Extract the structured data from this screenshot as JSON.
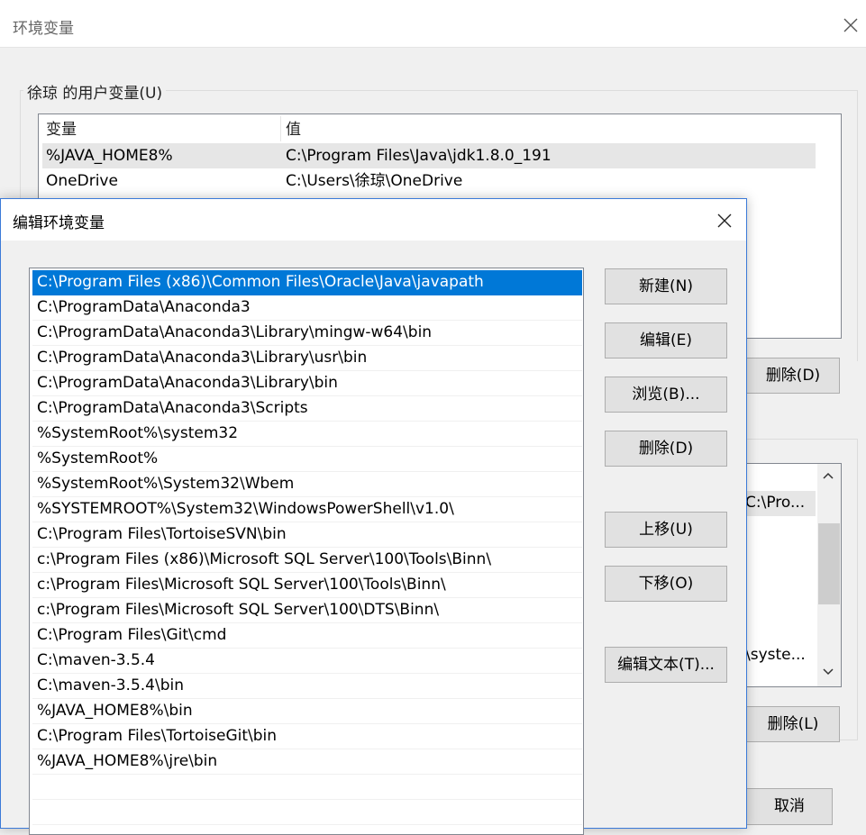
{
  "background_window": {
    "title": "环境变量",
    "user_vars_label": "徐琼 的用户变量(U)",
    "user_table": {
      "columns": [
        "变量",
        "值"
      ],
      "rows": [
        {
          "name": "%JAVA_HOME8%",
          "value": "C:\\Program Files\\Java\\jdk1.8.0_191"
        },
        {
          "name": "OneDrive",
          "value": "C:\\Users\\徐琼\\OneDrive"
        }
      ]
    },
    "delete_user_label": "删除(D)",
    "system_table_fragments": [
      "C:\\Pro...",
      "\\syste..."
    ],
    "delete_system_label": "删除(L)",
    "cancel_label": "取消"
  },
  "dialog": {
    "title": "编辑环境变量",
    "paths": [
      "C:\\Program Files (x86)\\Common Files\\Oracle\\Java\\javapath",
      "C:\\ProgramData\\Anaconda3",
      "C:\\ProgramData\\Anaconda3\\Library\\mingw-w64\\bin",
      "C:\\ProgramData\\Anaconda3\\Library\\usr\\bin",
      "C:\\ProgramData\\Anaconda3\\Library\\bin",
      "C:\\ProgramData\\Anaconda3\\Scripts",
      "%SystemRoot%\\system32",
      "%SystemRoot%",
      "%SystemRoot%\\System32\\Wbem",
      "%SYSTEMROOT%\\System32\\WindowsPowerShell\\v1.0\\",
      "C:\\Program Files\\TortoiseSVN\\bin",
      "c:\\Program Files (x86)\\Microsoft SQL Server\\100\\Tools\\Binn\\",
      "c:\\Program Files\\Microsoft SQL Server\\100\\Tools\\Binn\\",
      "c:\\Program Files\\Microsoft SQL Server\\100\\DTS\\Binn\\",
      "C:\\Program Files\\Git\\cmd",
      "C:\\maven-3.5.4",
      "C:\\maven-3.5.4\\bin",
      "%JAVA_HOME8%\\bin",
      "C:\\Program Files\\TortoiseGit\\bin",
      "%JAVA_HOME8%\\jre\\bin"
    ],
    "buttons": {
      "new": "新建(N)",
      "edit": "编辑(E)",
      "browse": "浏览(B)...",
      "delete": "删除(D)",
      "move_up": "上移(U)",
      "move_down": "下移(O)",
      "edit_text": "编辑文本(T)..."
    }
  },
  "colors": {
    "selection": "#0078d7",
    "dialog_border": "#3b7ad8"
  }
}
